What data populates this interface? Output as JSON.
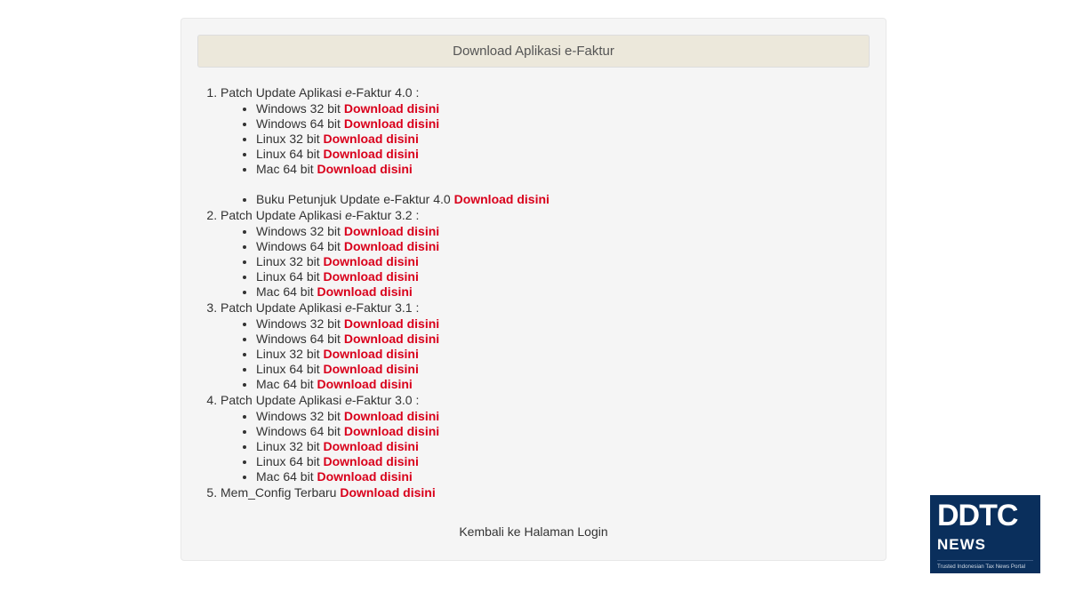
{
  "colors": {
    "link_red": "#d9001b",
    "panel_bg": "#f5f5f5",
    "heading_bg": "#ece8db"
  },
  "heading": "Download Aplikasi e-Faktur",
  "download_label": "Download disini",
  "footer_link": "Kembali ke Halaman Login",
  "logo": {
    "brand": "DDTC",
    "sub": "NEWS",
    "tagline": "Trusted Indonesian Tax News Portal"
  },
  "sections": [
    {
      "title_pre": "Patch Update Aplikasi ",
      "title_em": "e",
      "title_post": "-Faktur 4.0 :",
      "items": [
        "Windows 32 bit",
        "Windows 64 bit",
        "Linux 32 bit",
        "Linux 64 bit",
        "Mac 64 bit"
      ],
      "extra": [
        {
          "label": "Buku Petunjuk Update e-Faktur 4.0"
        }
      ]
    },
    {
      "title_pre": "Patch Update Aplikasi ",
      "title_em": "e",
      "title_post": "-Faktur 3.2 :",
      "items": [
        "Windows 32 bit",
        "Windows 64 bit",
        "Linux 32 bit",
        "Linux 64 bit",
        "Mac 64 bit"
      ]
    },
    {
      "title_pre": "Patch Update Aplikasi ",
      "title_em": "e",
      "title_post": "-Faktur 3.1 :",
      "items": [
        "Windows 32 bit",
        "Windows 64 bit",
        "Linux 32 bit",
        "Linux 64 bit",
        "Mac 64 bit"
      ]
    },
    {
      "title_pre": "Patch Update Aplikasi ",
      "title_em": "e",
      "title_post": "-Faktur 3.0 :",
      "items": [
        "Windows 32 bit",
        "Windows 64 bit",
        "Linux 32 bit",
        "Linux 64 bit",
        "Mac 64 bit"
      ]
    },
    {
      "title_plain": "Mem_Config Terbaru",
      "inline_download": true
    }
  ]
}
